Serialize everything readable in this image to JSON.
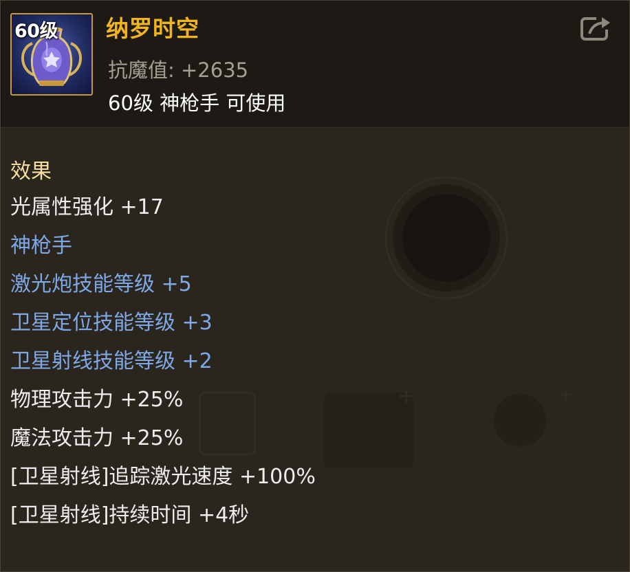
{
  "item": {
    "level_badge": "60级",
    "name": "纳罗时空",
    "stat": "抗魔值: +2635",
    "requirement": "60级 神枪手 可使用",
    "icon": "vase-icon"
  },
  "header": {
    "share_icon": "share-icon"
  },
  "effects": {
    "title": "效果",
    "lines": [
      {
        "text": "光属性强化 +17",
        "color": "white"
      },
      {
        "text": "神枪手",
        "color": "blue"
      },
      {
        "text": "激光炮技能等级 +5",
        "color": "blue"
      },
      {
        "text": "卫星定位技能等级 +3",
        "color": "blue"
      },
      {
        "text": "卫星射线技能等级 +2",
        "color": "blue"
      },
      {
        "text": "物理攻击力 +25%",
        "color": "white"
      },
      {
        "text": "魔法攻击力 +25%",
        "color": "white"
      },
      {
        "text": "[卫星射线]追踪激光速度 +100%",
        "color": "white"
      },
      {
        "text": "[卫星射线]持续时间 +4秒",
        "color": "white"
      }
    ]
  },
  "colors": {
    "name": "#f2b51e",
    "title": "#f5dea0",
    "stat": "#a59f92",
    "class_bonus": "#7ea8e6",
    "normal": "#eeeeee"
  }
}
